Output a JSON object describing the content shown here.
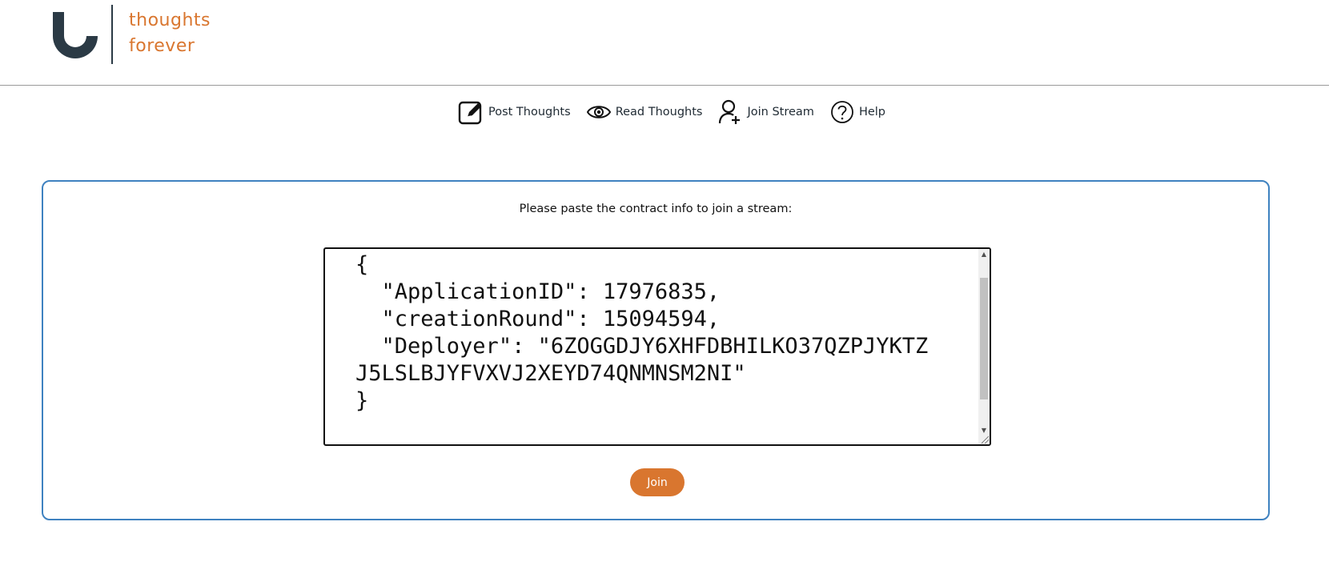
{
  "brand": {
    "line1": "thoughts",
    "line2": "forever",
    "accent_color": "#d9762f",
    "dark_color": "#2b3a45"
  },
  "nav": {
    "items": [
      {
        "label": "Post Thoughts",
        "icon": "edit-icon"
      },
      {
        "label": "Read Thoughts",
        "icon": "eye-icon"
      },
      {
        "label": "Join Stream",
        "icon": "user-add-icon"
      },
      {
        "label": "Help",
        "icon": "help-icon"
      }
    ]
  },
  "join_form": {
    "prompt": "Please paste the contract info to join a stream:",
    "contract_info": "{\n  \"ApplicationID\": 17976835,\n  \"creationRound\": 15094594,\n  \"Deployer\": \"6ZOGGDJY6XHFDBHILKO37QZPJYKTZJ5LSLBJYFVXVJ2XEYD74QNMNSM2NI\"\n}",
    "button_label": "Join",
    "border_color": "#3f82c0"
  }
}
